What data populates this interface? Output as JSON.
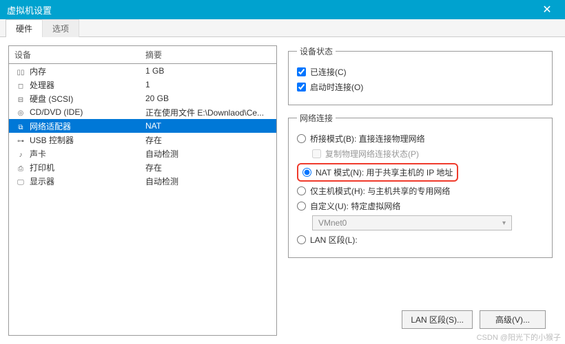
{
  "titlebar": {
    "title": "虚拟机设置",
    "close": "✕"
  },
  "tabs": {
    "hardware": "硬件",
    "options": "选项"
  },
  "list": {
    "header_device": "设备",
    "header_summary": "摘要",
    "rows": [
      {
        "icon": "memory-icon",
        "name": "内存",
        "summary": "1 GB"
      },
      {
        "icon": "cpu-icon",
        "name": "处理器",
        "summary": "1"
      },
      {
        "icon": "disk-icon",
        "name": "硬盘 (SCSI)",
        "summary": "20 GB"
      },
      {
        "icon": "disc-icon",
        "name": "CD/DVD (IDE)",
        "summary": "正在使用文件 E:\\Downlaod\\Ce..."
      },
      {
        "icon": "network-icon",
        "name": "网络适配器",
        "summary": "NAT",
        "selected": true
      },
      {
        "icon": "usb-icon",
        "name": "USB 控制器",
        "summary": "存在"
      },
      {
        "icon": "sound-icon",
        "name": "声卡",
        "summary": "自动检测"
      },
      {
        "icon": "printer-icon",
        "name": "打印机",
        "summary": "存在"
      },
      {
        "icon": "display-icon",
        "name": "显示器",
        "summary": "自动检测"
      }
    ]
  },
  "deviceStatus": {
    "legend": "设备状态",
    "connected": "已连接(C)",
    "connectAtPower": "启动时连接(O)"
  },
  "netConn": {
    "legend": "网络连接",
    "bridged": "桥接模式(B): 直接连接物理网络",
    "replicate": "复制物理网络连接状态(P)",
    "nat": "NAT 模式(N): 用于共享主机的 IP 地址",
    "hostonly": "仅主机模式(H): 与主机共享的专用网络",
    "custom": "自定义(U): 特定虚拟网络",
    "vmnet": "VMnet0",
    "lan": "LAN 区段(L):"
  },
  "buttons": {
    "lanseg": "LAN 区段(S)...",
    "advanced": "高级(V)..."
  },
  "watermark": "CSDN @阳光下的小猴子"
}
